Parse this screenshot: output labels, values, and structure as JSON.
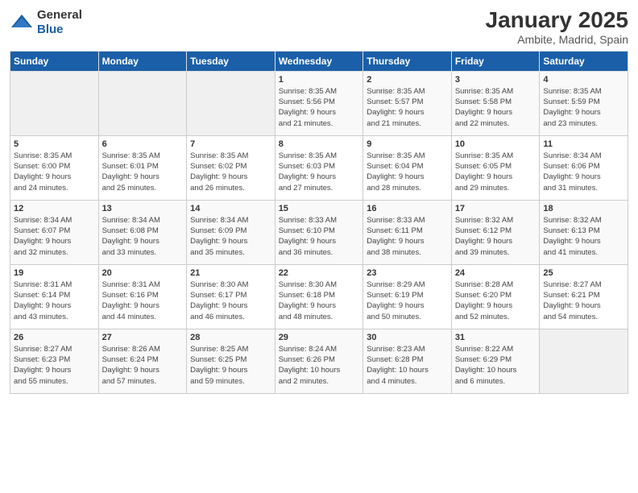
{
  "logo": {
    "general": "General",
    "blue": "Blue"
  },
  "header": {
    "month": "January 2025",
    "location": "Ambite, Madrid, Spain"
  },
  "weekdays": [
    "Sunday",
    "Monday",
    "Tuesday",
    "Wednesday",
    "Thursday",
    "Friday",
    "Saturday"
  ],
  "weeks": [
    [
      {
        "day": "",
        "info": ""
      },
      {
        "day": "",
        "info": ""
      },
      {
        "day": "",
        "info": ""
      },
      {
        "day": "1",
        "info": "Sunrise: 8:35 AM\nSunset: 5:56 PM\nDaylight: 9 hours\nand 21 minutes."
      },
      {
        "day": "2",
        "info": "Sunrise: 8:35 AM\nSunset: 5:57 PM\nDaylight: 9 hours\nand 21 minutes."
      },
      {
        "day": "3",
        "info": "Sunrise: 8:35 AM\nSunset: 5:58 PM\nDaylight: 9 hours\nand 22 minutes."
      },
      {
        "day": "4",
        "info": "Sunrise: 8:35 AM\nSunset: 5:59 PM\nDaylight: 9 hours\nand 23 minutes."
      }
    ],
    [
      {
        "day": "5",
        "info": "Sunrise: 8:35 AM\nSunset: 6:00 PM\nDaylight: 9 hours\nand 24 minutes."
      },
      {
        "day": "6",
        "info": "Sunrise: 8:35 AM\nSunset: 6:01 PM\nDaylight: 9 hours\nand 25 minutes."
      },
      {
        "day": "7",
        "info": "Sunrise: 8:35 AM\nSunset: 6:02 PM\nDaylight: 9 hours\nand 26 minutes."
      },
      {
        "day": "8",
        "info": "Sunrise: 8:35 AM\nSunset: 6:03 PM\nDaylight: 9 hours\nand 27 minutes."
      },
      {
        "day": "9",
        "info": "Sunrise: 8:35 AM\nSunset: 6:04 PM\nDaylight: 9 hours\nand 28 minutes."
      },
      {
        "day": "10",
        "info": "Sunrise: 8:35 AM\nSunset: 6:05 PM\nDaylight: 9 hours\nand 29 minutes."
      },
      {
        "day": "11",
        "info": "Sunrise: 8:34 AM\nSunset: 6:06 PM\nDaylight: 9 hours\nand 31 minutes."
      }
    ],
    [
      {
        "day": "12",
        "info": "Sunrise: 8:34 AM\nSunset: 6:07 PM\nDaylight: 9 hours\nand 32 minutes."
      },
      {
        "day": "13",
        "info": "Sunrise: 8:34 AM\nSunset: 6:08 PM\nDaylight: 9 hours\nand 33 minutes."
      },
      {
        "day": "14",
        "info": "Sunrise: 8:34 AM\nSunset: 6:09 PM\nDaylight: 9 hours\nand 35 minutes."
      },
      {
        "day": "15",
        "info": "Sunrise: 8:33 AM\nSunset: 6:10 PM\nDaylight: 9 hours\nand 36 minutes."
      },
      {
        "day": "16",
        "info": "Sunrise: 8:33 AM\nSunset: 6:11 PM\nDaylight: 9 hours\nand 38 minutes."
      },
      {
        "day": "17",
        "info": "Sunrise: 8:32 AM\nSunset: 6:12 PM\nDaylight: 9 hours\nand 39 minutes."
      },
      {
        "day": "18",
        "info": "Sunrise: 8:32 AM\nSunset: 6:13 PM\nDaylight: 9 hours\nand 41 minutes."
      }
    ],
    [
      {
        "day": "19",
        "info": "Sunrise: 8:31 AM\nSunset: 6:14 PM\nDaylight: 9 hours\nand 43 minutes."
      },
      {
        "day": "20",
        "info": "Sunrise: 8:31 AM\nSunset: 6:16 PM\nDaylight: 9 hours\nand 44 minutes."
      },
      {
        "day": "21",
        "info": "Sunrise: 8:30 AM\nSunset: 6:17 PM\nDaylight: 9 hours\nand 46 minutes."
      },
      {
        "day": "22",
        "info": "Sunrise: 8:30 AM\nSunset: 6:18 PM\nDaylight: 9 hours\nand 48 minutes."
      },
      {
        "day": "23",
        "info": "Sunrise: 8:29 AM\nSunset: 6:19 PM\nDaylight: 9 hours\nand 50 minutes."
      },
      {
        "day": "24",
        "info": "Sunrise: 8:28 AM\nSunset: 6:20 PM\nDaylight: 9 hours\nand 52 minutes."
      },
      {
        "day": "25",
        "info": "Sunrise: 8:27 AM\nSunset: 6:21 PM\nDaylight: 9 hours\nand 54 minutes."
      }
    ],
    [
      {
        "day": "26",
        "info": "Sunrise: 8:27 AM\nSunset: 6:23 PM\nDaylight: 9 hours\nand 55 minutes."
      },
      {
        "day": "27",
        "info": "Sunrise: 8:26 AM\nSunset: 6:24 PM\nDaylight: 9 hours\nand 57 minutes."
      },
      {
        "day": "28",
        "info": "Sunrise: 8:25 AM\nSunset: 6:25 PM\nDaylight: 9 hours\nand 59 minutes."
      },
      {
        "day": "29",
        "info": "Sunrise: 8:24 AM\nSunset: 6:26 PM\nDaylight: 10 hours\nand 2 minutes."
      },
      {
        "day": "30",
        "info": "Sunrise: 8:23 AM\nSunset: 6:28 PM\nDaylight: 10 hours\nand 4 minutes."
      },
      {
        "day": "31",
        "info": "Sunrise: 8:22 AM\nSunset: 6:29 PM\nDaylight: 10 hours\nand 6 minutes."
      },
      {
        "day": "",
        "info": ""
      }
    ]
  ]
}
